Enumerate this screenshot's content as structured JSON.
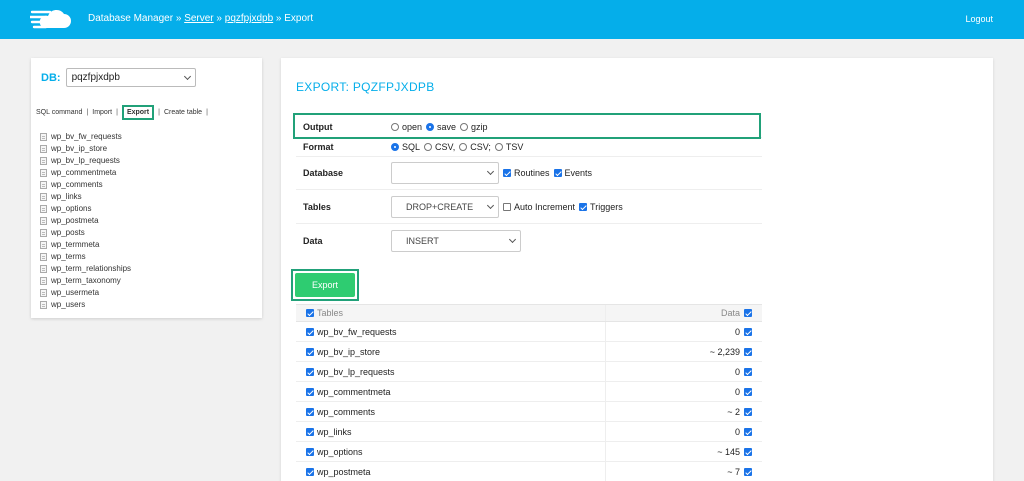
{
  "header": {
    "app_title": "Database Manager",
    "sep1": "»",
    "crumb_server": "Server",
    "sep2": "»",
    "crumb_db": "pqzfpjxdpb",
    "sep3": "»",
    "crumb_current": "Export",
    "logout": "Logout"
  },
  "sidebar": {
    "db_label": "DB:",
    "db_value": "pqzfpjxdpb",
    "links": [
      "SQL command",
      "Import",
      "Export",
      "Create table"
    ],
    "tables": [
      "wp_bv_fw_requests",
      "wp_bv_ip_store",
      "wp_bv_lp_requests",
      "wp_commentmeta",
      "wp_comments",
      "wp_links",
      "wp_options",
      "wp_postmeta",
      "wp_posts",
      "wp_termmeta",
      "wp_terms",
      "wp_term_relationships",
      "wp_term_taxonomy",
      "wp_usermeta",
      "wp_users"
    ]
  },
  "main": {
    "title": "EXPORT: PQZFPJXDPB",
    "output": {
      "label": "Output",
      "options": [
        "open",
        "save",
        "gzip"
      ],
      "selected": "save"
    },
    "format": {
      "label": "Format",
      "options": [
        "SQL",
        "CSV,",
        "CSV;",
        "TSV"
      ],
      "selected": "SQL"
    },
    "database": {
      "label": "Database",
      "value": "",
      "routines": "Routines",
      "events": "Events"
    },
    "tables_opt": {
      "label": "Tables",
      "value": "DROP+CREATE",
      "auto_increment": "Auto Increment",
      "triggers": "Triggers"
    },
    "data_opt": {
      "label": "Data",
      "value": "INSERT"
    },
    "export_button": "Export",
    "list_header": {
      "tables": "Tables",
      "data": "Data"
    },
    "rows": [
      {
        "name": "wp_bv_fw_requests",
        "data": "0"
      },
      {
        "name": "wp_bv_ip_store",
        "data": "~ 2,239"
      },
      {
        "name": "wp_bv_lp_requests",
        "data": "0"
      },
      {
        "name": "wp_commentmeta",
        "data": "0"
      },
      {
        "name": "wp_comments",
        "data": "~ 2"
      },
      {
        "name": "wp_links",
        "data": "0"
      },
      {
        "name": "wp_options",
        "data": "~ 145"
      },
      {
        "name": "wp_postmeta",
        "data": "~ 7"
      }
    ]
  }
}
